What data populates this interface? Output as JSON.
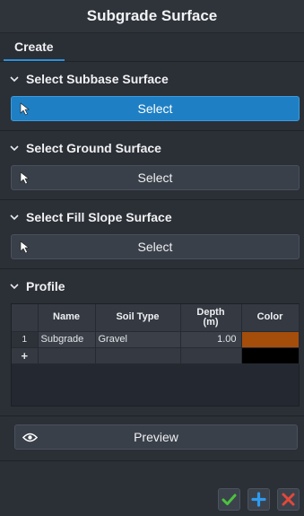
{
  "window": {
    "title": "Subgrade Surface"
  },
  "tabs": [
    {
      "label": "Create"
    }
  ],
  "sections": {
    "subbase": {
      "title": "Select Subbase Surface",
      "button_label": "Select"
    },
    "ground": {
      "title": "Select Ground Surface",
      "button_label": "Select"
    },
    "fill_slope": {
      "title": "Select Fill Slope Surface",
      "button_label": "Select"
    },
    "profile": {
      "title": "Profile",
      "columns": [
        "Name",
        "Soil Type",
        "Depth\n(m)",
        "Color"
      ],
      "rows": [
        {
          "index": "1",
          "name": "Subgrade",
          "soil_type": "Gravel",
          "depth": "1.00",
          "color": "#a54d0b"
        }
      ],
      "new_row_marker": "+",
      "new_row_color": "#000000"
    }
  },
  "preview": {
    "label": "Preview"
  },
  "footer": {
    "ok_icon": "check-icon",
    "add_icon": "plus-icon",
    "cancel_icon": "x-icon"
  },
  "colors": {
    "accent": "#1e7fc4",
    "ok": "#4cc23f",
    "add": "#2d9bf0",
    "cancel": "#e2483a"
  }
}
